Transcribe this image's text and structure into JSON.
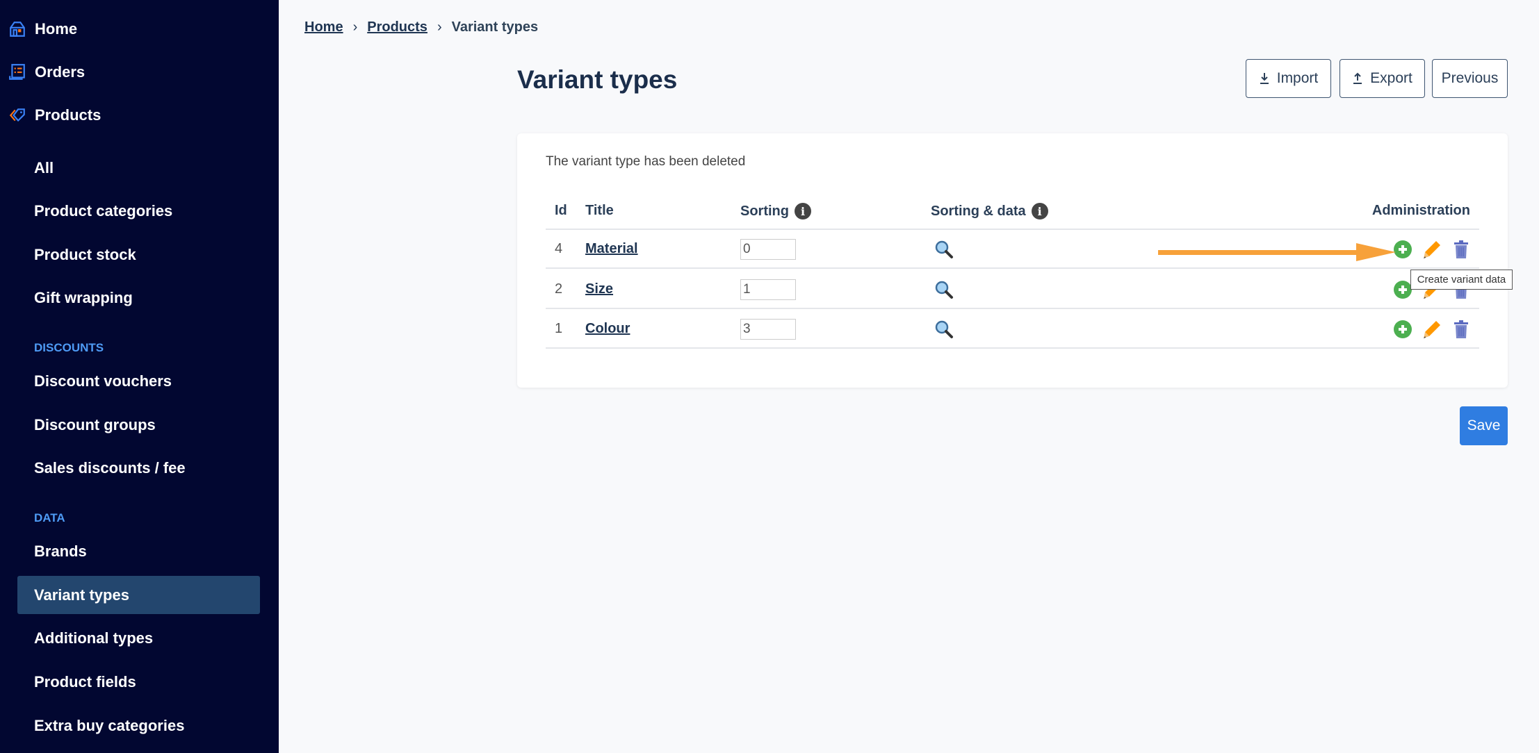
{
  "sidebar": {
    "top": [
      {
        "label": "Home",
        "icon": "home-icon"
      },
      {
        "label": "Orders",
        "icon": "orders-icon"
      },
      {
        "label": "Products",
        "icon": "tag-icon"
      }
    ],
    "products": [
      "All",
      "Product categories",
      "Product stock",
      "Gift wrapping"
    ],
    "discounts_heading": "DISCOUNTS",
    "discounts": [
      "Discount vouchers",
      "Discount groups",
      "Sales discounts / fee"
    ],
    "data_heading": "DATA",
    "data": [
      "Brands",
      "Variant types",
      "Additional types",
      "Product fields",
      "Extra buy categories"
    ],
    "active": "Variant types"
  },
  "breadcrumb": [
    "Home",
    "Products",
    "Variant types"
  ],
  "title": "Variant types",
  "buttons": {
    "import": "Import",
    "export": "Export",
    "previous": "Previous",
    "save": "Save"
  },
  "message": "The variant type has been deleted",
  "table": {
    "headers": {
      "id": "Id",
      "title": "Title",
      "sorting": "Sorting",
      "sorting_data": "Sorting & data",
      "admin": "Administration"
    },
    "rows": [
      {
        "id": "4",
        "title": "Material",
        "sorting": "0"
      },
      {
        "id": "2",
        "title": "Size",
        "sorting": "1"
      },
      {
        "id": "1",
        "title": "Colour",
        "sorting": "3"
      }
    ]
  },
  "tooltip": "Create variant data",
  "colors": {
    "sidebar": "#020731",
    "active": "#23466e",
    "accent": "#2f7de1",
    "add": "#4caf50",
    "edit": "#ff9800",
    "delete": "#7986cb",
    "arrow": "#f7a13a"
  }
}
